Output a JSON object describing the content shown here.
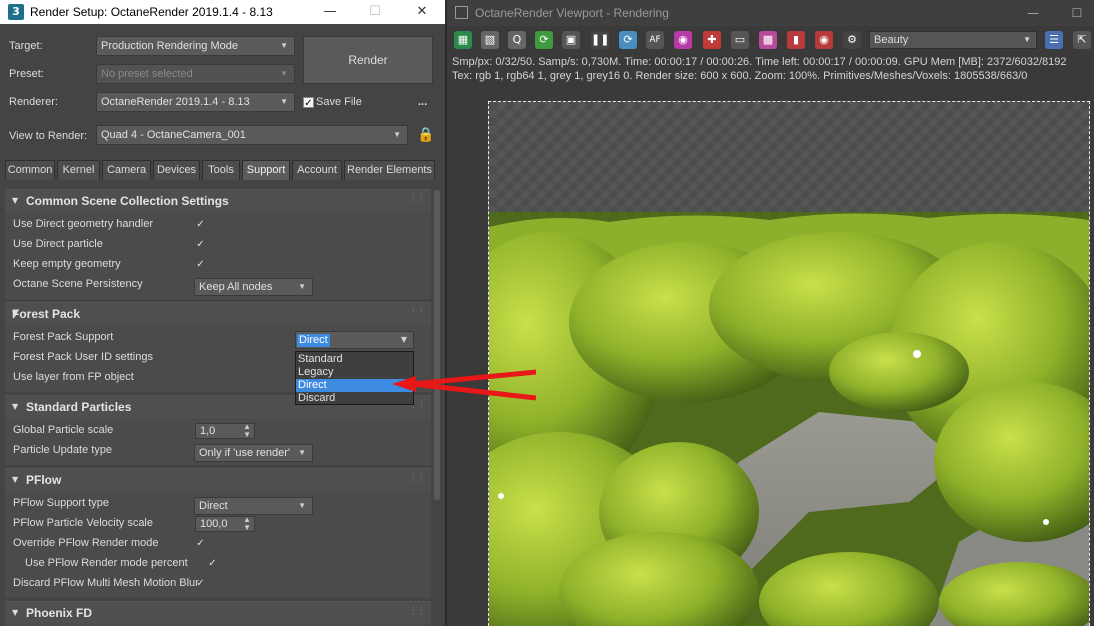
{
  "render_setup": {
    "title": "Render Setup: OctaneRender 2019.1.4 - 8.13",
    "app_icon": "3",
    "target_label": "Target:",
    "target_value": "Production Rendering Mode",
    "preset_label": "Preset:",
    "preset_value": "No preset selected",
    "renderer_label": "Renderer:",
    "renderer_value": "OctaneRender 2019.1.4 - 8.13",
    "save_file_label": "Save File",
    "more_label": "...",
    "view_label": "View to Render:",
    "view_value": "Quad 4 - OctaneCamera_001",
    "render_button": "Render",
    "tabs": [
      "Common",
      "Kernel",
      "Camera",
      "Devices",
      "Tools",
      "Support",
      "Account",
      "Render Elements"
    ],
    "active_tab": "Support"
  },
  "sections": {
    "common_scene": {
      "title": "Common Scene Collection Settings",
      "rows": [
        "Use Direct geometry handler",
        "Use Direct particle",
        "Keep empty geometry",
        "Octane Scene Persistency"
      ],
      "persistency_value": "Keep All nodes"
    },
    "forest_pack": {
      "title": "Forest Pack",
      "rows": [
        "Forest Pack Support",
        "Forest Pack User ID settings",
        "Use layer from FP object"
      ],
      "support_value": "Direct",
      "options": [
        "Standard",
        "Legacy",
        "Direct",
        "Discard"
      ],
      "selected_option": "Direct"
    },
    "standard_particles": {
      "title": "Standard Particles",
      "rows": [
        "Global Particle scale",
        "Particle Update type"
      ],
      "scale_value": "1,0",
      "update_value": "Only if 'use render'"
    },
    "pflow": {
      "title": "PFlow",
      "rows": [
        "PFlow Support type",
        "PFlow Particle Velocity scale",
        "Override PFlow Render mode",
        "Use PFlow Render mode percent",
        "Discard PFlow Multi Mesh Motion Blur"
      ],
      "support_value": "Direct",
      "velocity_value": "100,0"
    },
    "phoenix": {
      "title": "Phoenix FD"
    }
  },
  "viewport": {
    "title": "OctaneRender Viewport - Rendering",
    "pass_value": "Beauty",
    "info_line1": "Smp/px: 0/32/50.   Samp/s: 0,730M.   Time: 00:00:17 / 00:00:26.   Time left: 00:00:17 / 00:00:09.   GPU Mem [MB]: 2372/6032/8192",
    "info_line2": "Tex: rgb 1, rgb64 1, grey 1, grey16 0.   Render size: 600 x 600.   Zoom: 100%.   Primitives/Meshes/Voxels: 1805538/663/0"
  },
  "colors": {
    "annotation_arrow": "#e81818",
    "selection": "#3c8be0",
    "foliage": "#9bbf2a"
  }
}
